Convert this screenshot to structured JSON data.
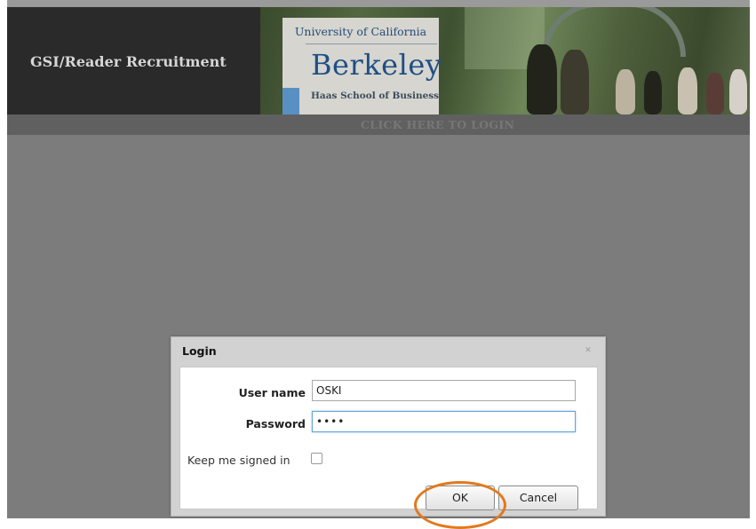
{
  "app": {
    "title": "GSI/Reader Recruitment"
  },
  "logo": {
    "university": "University of California",
    "campus": "Berkeley",
    "school": "Haas School of Business"
  },
  "nav": {
    "login_link": "CLICK HERE TO LOGIN"
  },
  "dialog": {
    "title": "Login",
    "close_icon": "close-icon",
    "username_label": "User name",
    "username_value": "OSKI",
    "password_label": "Password",
    "password_masked": "••••",
    "keep_signed_in_label": "Keep me signed in",
    "keep_signed_in_checked": false,
    "ok_label": "OK",
    "cancel_label": "Cancel"
  },
  "colors": {
    "header_bg": "#2a2a2a",
    "page_bg": "#7c7c7c",
    "highlight_circle": "#e07a1f",
    "berkeley_blue": "#1d4f86"
  }
}
